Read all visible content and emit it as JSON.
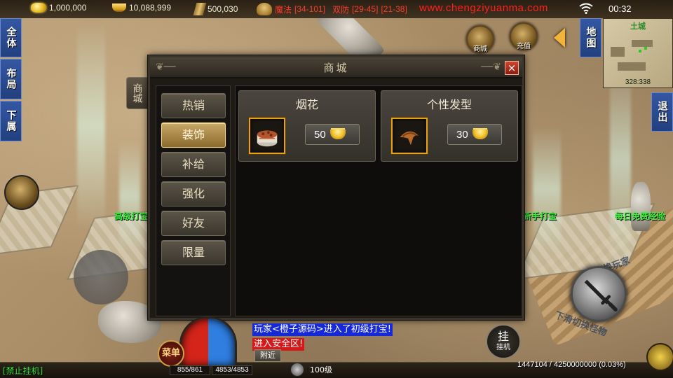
{
  "topbar": {
    "gold": "1,000,000",
    "ingots": "10,088,999",
    "cloth": "500,030",
    "magic_label": "魔法",
    "magic_range": "[34-101]",
    "def_label": "双防",
    "def_range": "[29-45]",
    "extra_range": "[21-38]",
    "watermark": "www.chengziyuanma.com",
    "clock": "00:32"
  },
  "left_tabs": [
    "全体",
    "布局",
    "下属"
  ],
  "right_tabs": {
    "map": "地图",
    "exit": "退出"
  },
  "minimap": {
    "title": "土城",
    "coords": "328:338"
  },
  "round_buttons": {
    "shop": "商城",
    "recharge": "充值"
  },
  "shop": {
    "title": "商城",
    "side_label": "商城",
    "close_label": "×",
    "categories": [
      {
        "label": "热销",
        "active": false
      },
      {
        "label": "装饰",
        "active": true
      },
      {
        "label": "补给",
        "active": false
      },
      {
        "label": "强化",
        "active": false
      },
      {
        "label": "好友",
        "active": false
      },
      {
        "label": "限量",
        "active": false
      }
    ],
    "items": [
      {
        "name": "烟花",
        "price": "50",
        "icon": "firework-cake-icon"
      },
      {
        "name": "个性发型",
        "price": "30",
        "icon": "hairstyle-icon"
      }
    ]
  },
  "npc_labels": {
    "left": "高级打宝",
    "right": "新手打宝",
    "far_right": "每日免费经验"
  },
  "skill_hints": {
    "up": "上滑切换玩家",
    "down": "下滑切换怪物"
  },
  "chat": {
    "line1": "玩家<橙子源码>进入了初级打宝!",
    "line2": "进入安全区!",
    "nearby_tab": "附近"
  },
  "hud": {
    "menu_label": "菜单",
    "hp": "855/861",
    "mp": "4853/4853",
    "level": "100级",
    "exp": "1447104 / 4250000000 (0.03%)",
    "hang_label": "挂",
    "hang_sub": "挂机",
    "ban_afk": "[禁止挂机]"
  },
  "colors": {
    "accent_gold": "#e6a318",
    "chat_system_bg": "#1629d8",
    "chat_warn_bg": "#d71818",
    "npc_green": "#3cf23c",
    "side_tab_blue": "#2b4b91"
  }
}
